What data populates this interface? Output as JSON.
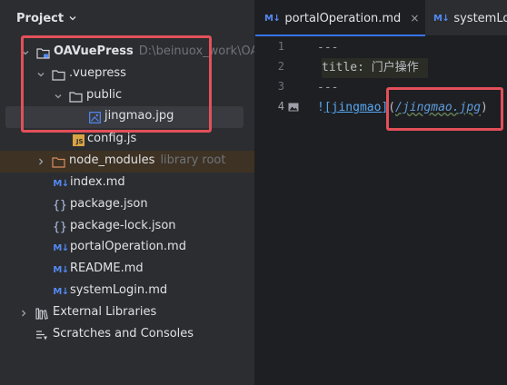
{
  "project_panel": {
    "title": "Project",
    "tree": [
      {
        "label": "OAVuePress",
        "hint": "D:\\beinuox_work\\OAV",
        "icon": "module-folder-icon",
        "expanded": true
      },
      {
        "label": ".vuepress",
        "icon": "folder-icon",
        "expanded": true
      },
      {
        "label": "public",
        "icon": "folder-icon",
        "expanded": true
      },
      {
        "label": "jingmao.jpg",
        "icon": "image-file-icon",
        "selected": true
      },
      {
        "label": "config.js",
        "icon": "js-file-icon"
      },
      {
        "label": "node_modules",
        "hint": "library root",
        "icon": "excluded-folder-icon",
        "expanded": false
      },
      {
        "label": "index.md",
        "icon": "markdown-file-icon"
      },
      {
        "label": "package.json",
        "icon": "json-file-icon"
      },
      {
        "label": "package-lock.json",
        "icon": "json-file-icon"
      },
      {
        "label": "portalOperation.md",
        "icon": "markdown-file-icon"
      },
      {
        "label": "README.md",
        "icon": "markdown-file-icon"
      },
      {
        "label": "systemLogin.md",
        "icon": "markdown-file-icon"
      },
      {
        "label": "External Libraries",
        "icon": "library-icon",
        "expanded": false
      },
      {
        "label": "Scratches and Consoles",
        "icon": "scratches-icon"
      }
    ]
  },
  "editor": {
    "tabs": [
      {
        "label": "portalOperation.md",
        "icon_text": "M↓",
        "active": true,
        "close": "×"
      },
      {
        "label": "systemLogin.md",
        "icon_text": "M↓",
        "active": false
      }
    ],
    "lines": [
      {
        "num": "1",
        "text": "---"
      },
      {
        "num": "2",
        "text": "title: 门户操作"
      },
      {
        "num": "3",
        "text": "---"
      },
      {
        "num": "4",
        "bang": "!",
        "link_text": "[jingmao]",
        "paren_open": "(",
        "url": "/jingmao.jpg",
        "paren_close": ")"
      }
    ]
  },
  "colors": {
    "annotation": "#e3505a",
    "accent": "#3574f0",
    "background": "#1e1f22",
    "panel": "#2b2d30"
  }
}
